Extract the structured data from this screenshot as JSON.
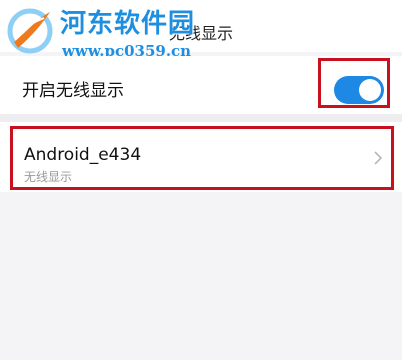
{
  "watermark": {
    "title": "河东软件园",
    "url": "www.pc0359.cn"
  },
  "header": {
    "title": "无线显示"
  },
  "toggle": {
    "label": "开启无线显示",
    "enabled": true,
    "on_color": "#1e88e5"
  },
  "device": {
    "name": "Android_e434",
    "subtitle": "无线显示"
  },
  "colors": {
    "highlight": "#c8101e",
    "watermark": "#1e8fe0"
  }
}
